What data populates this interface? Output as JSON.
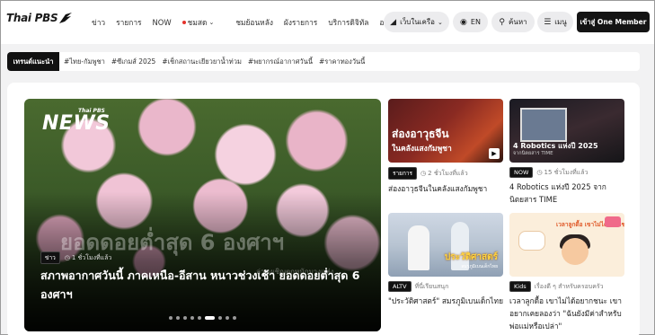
{
  "header": {
    "logo_text": "Thai PBS",
    "nav": [
      {
        "label": "ข่าว",
        "dot": false,
        "chevron": false
      },
      {
        "label": "รายการ",
        "dot": false,
        "chevron": false
      },
      {
        "label": "NOW",
        "dot": false,
        "chevron": false
      },
      {
        "label": "ชมสด",
        "dot": true,
        "chevron": true
      },
      {
        "label": "ชมย้อนหลัง",
        "dot": false,
        "chevron": false
      },
      {
        "label": "ผังรายการ",
        "dot": false,
        "chevron": false
      },
      {
        "label": "บริการดิจิทัล",
        "dot": false,
        "chevron": false
      },
      {
        "label": "องค์กร",
        "dot": false,
        "chevron": true
      }
    ],
    "network_label": "เว็บในเครือ",
    "language_label": "EN",
    "search_label": "ค้นหา",
    "menu_label": "เมนู",
    "member_label": "เข้าสู่ One Member"
  },
  "trending": {
    "label": "เทรนด์แนะนำ",
    "tags": [
      "#ไทย-กัมพูชา",
      "#ซีเกมส์ 2025",
      "#เช็กสถานะเยียวยาน้ำท่วม",
      "#พยากรณ์อากาศวันนี้",
      "#ราคาทองวันนี้"
    ]
  },
  "hero": {
    "logo_small": "Thai PBS",
    "logo_big": "NEWS",
    "overlay_text": "ยอดดอยต่ำสุด 6 องศาฯ",
    "overlay_sub": "ล่างเผชิญตกหนักบางแห่ง",
    "category": "ข่าว",
    "time_ago": "1 ชั่วโมงที่แล้ว",
    "title": "สภาพอากาศวันนี้ ภาคเหนือ-อีสาน หนาวช่วงเช้า ยอดดอยต่ำสุด 6 องศาฯ",
    "slide_count": 9,
    "active_slide": 5
  },
  "cards": [
    {
      "thumb_big": "ส่องอาวุธจีน",
      "thumb_small": "ในคลังแสงกัมพูชา",
      "category": "รายการ",
      "time_ago": "2 ชั่วโมงที่แล้ว",
      "title": "ส่องอาวุธจีนในคลังแสงกัมพูชา"
    },
    {
      "thumb_big": "4 Robotics แห่งปี 2025",
      "thumb_small": "จากนิตยสาร TIME",
      "category": "NOW",
      "time_ago": "15 ชั่วโมงที่แล้ว",
      "title": "4 Robotics แห่งปี 2025 จากนิตยสาร TIME"
    },
    {
      "thumb_big": "ประวัติศาสตร์",
      "thumb_small": "สมรภูมิเบนเด็กไทย",
      "category": "ALTV",
      "time_ago": "ที่นี่เรียนสนุก",
      "title": "\"ประวัติศาสตร์\" สมรภูมิเบนเด็กไทย"
    },
    {
      "thumb_big": "เวลาลูกดื้อ เขาไม่ได้อยากชนะเรา",
      "thumb_small": "",
      "category": "Kids",
      "time_ago": "เรื่องดี ๆ สำหรับครอบครัว",
      "title": "เวลาลูกดื้อ เขาไม่ได้อยากชนะ เขาอยากเคยลองว่า \"ฉันยังมีค่าสำหรับพ่อแม่หรือเปล่า\""
    }
  ]
}
